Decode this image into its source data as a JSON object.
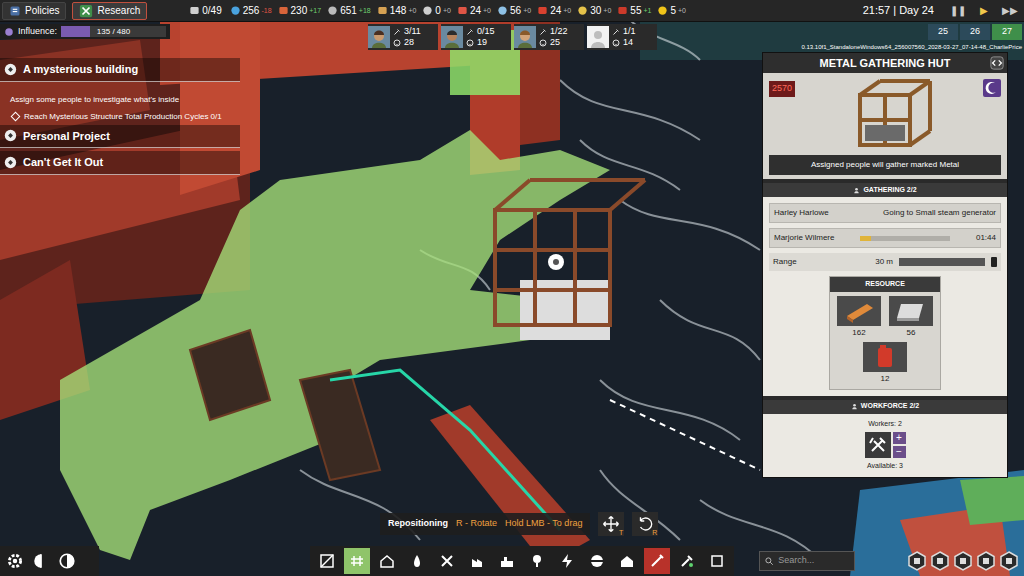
{
  "top_bar": {
    "buttons": [
      {
        "label": "Policies",
        "selected": false
      },
      {
        "label": "Research",
        "selected": true
      }
    ],
    "resources": [
      {
        "value": "0/49",
        "delta": "",
        "color": "#cfcfcf"
      },
      {
        "value": "256",
        "delta": "-18",
        "color": "#e05545"
      },
      {
        "value": "230",
        "delta": "+17",
        "color": "#6fd16f"
      },
      {
        "value": "651",
        "delta": "+18",
        "color": "#6fd16f"
      },
      {
        "value": "148",
        "delta": "+0",
        "color": "#bbbbbb"
      },
      {
        "value": "0",
        "delta": "+0",
        "color": "#bbbbbb"
      },
      {
        "value": "24",
        "delta": "+0",
        "color": "#bbbbbb"
      },
      {
        "value": "56",
        "delta": "+0",
        "color": "#bbbbbb"
      },
      {
        "value": "24",
        "delta": "+0",
        "color": "#bbbbbb"
      },
      {
        "value": "30",
        "delta": "+0",
        "color": "#bbbbbb"
      },
      {
        "value": "55",
        "delta": "+1",
        "color": "#6fd16f"
      },
      {
        "value": "5",
        "delta": "+0",
        "color": "#bbbbbb"
      }
    ],
    "clock": "21:57 | Day 24",
    "speed": [
      {
        "symbol": "❚❚",
        "selected": false
      },
      {
        "symbol": "▶",
        "selected": true
      },
      {
        "symbol": "▶▶",
        "selected": false
      }
    ]
  },
  "influence": {
    "label": "Influence:",
    "value": "135 / 480",
    "level": 0.28
  },
  "workers": [
    {
      "assigned": "3/11",
      "mood": "28"
    },
    {
      "assigned": "0/15",
      "mood": "19"
    },
    {
      "assigned": "1/22",
      "mood": "25"
    },
    {
      "assigned": "1/1",
      "mood": "14"
    }
  ],
  "build_info": "0.13.10f1_StandaloneWindows64_256007560_2028-03-27_07-14-48_CharliePrice",
  "minimap": [
    {
      "label": "25",
      "selected": false
    },
    {
      "label": "26",
      "selected": false
    },
    {
      "label": "27",
      "selected": true
    }
  ],
  "quests": [
    {
      "kind": "title",
      "text": "A mysterious building"
    },
    {
      "kind": "description",
      "text": "Assign some people to investigate what's inside"
    },
    {
      "kind": "objective",
      "text": "Reach Mysterious Structure Total Production Cycles 0/1"
    },
    {
      "kind": "title",
      "text": "Personal Project"
    },
    {
      "kind": "title",
      "text": "Can't Get It Out"
    }
  ],
  "panel": {
    "title": "METAL GATHERING HUT",
    "badge": "2570",
    "caption": "Assigned people will gather marked Metal",
    "gathering_header": "GATHERING 2/2",
    "gatherers": [
      {
        "kind": "status",
        "name": "Harley Harlowe",
        "status": "Going to Small steam generator"
      },
      {
        "kind": "progress",
        "name": "Marjorie Wilmere",
        "level": 0.12,
        "time": "01:44"
      }
    ],
    "range": {
      "label": "Range",
      "value": "30 m",
      "level": 1
    },
    "resource_header": "RESOURCE",
    "resources": [
      {
        "amount": "162"
      },
      {
        "amount": "56"
      },
      {
        "amount": "12"
      }
    ],
    "workforce_header": "WORKFORCE 2/2",
    "workers_label": "Workers: 2",
    "plus": "+",
    "minus": "−",
    "available_label": "Available: 3"
  },
  "hint": {
    "parts": [
      "Repositioning",
      "R - Rotate",
      "Hold LMB - To drag"
    ],
    "keys": [
      "T",
      "R"
    ]
  },
  "toolbar": [
    {
      "kind": "tool",
      "selected": false
    },
    {
      "kind": "tool",
      "selected": true
    },
    {
      "kind": "tool",
      "selected": false
    },
    {
      "kind": "tool",
      "selected": false
    },
    {
      "kind": "tool",
      "selected": false
    },
    {
      "kind": "tool",
      "selected": false
    },
    {
      "kind": "tool",
      "selected": false
    },
    {
      "kind": "tool",
      "selected": false
    },
    {
      "kind": "tool",
      "selected": false
    },
    {
      "kind": "tool",
      "selected": false
    },
    {
      "kind": "tool",
      "selected": false
    },
    {
      "kind": "demolish",
      "selected": false
    },
    {
      "kind": "tool",
      "selected": false
    },
    {
      "kind": "tool",
      "selected": false
    }
  ],
  "search": {
    "placeholder": "Search..."
  }
}
